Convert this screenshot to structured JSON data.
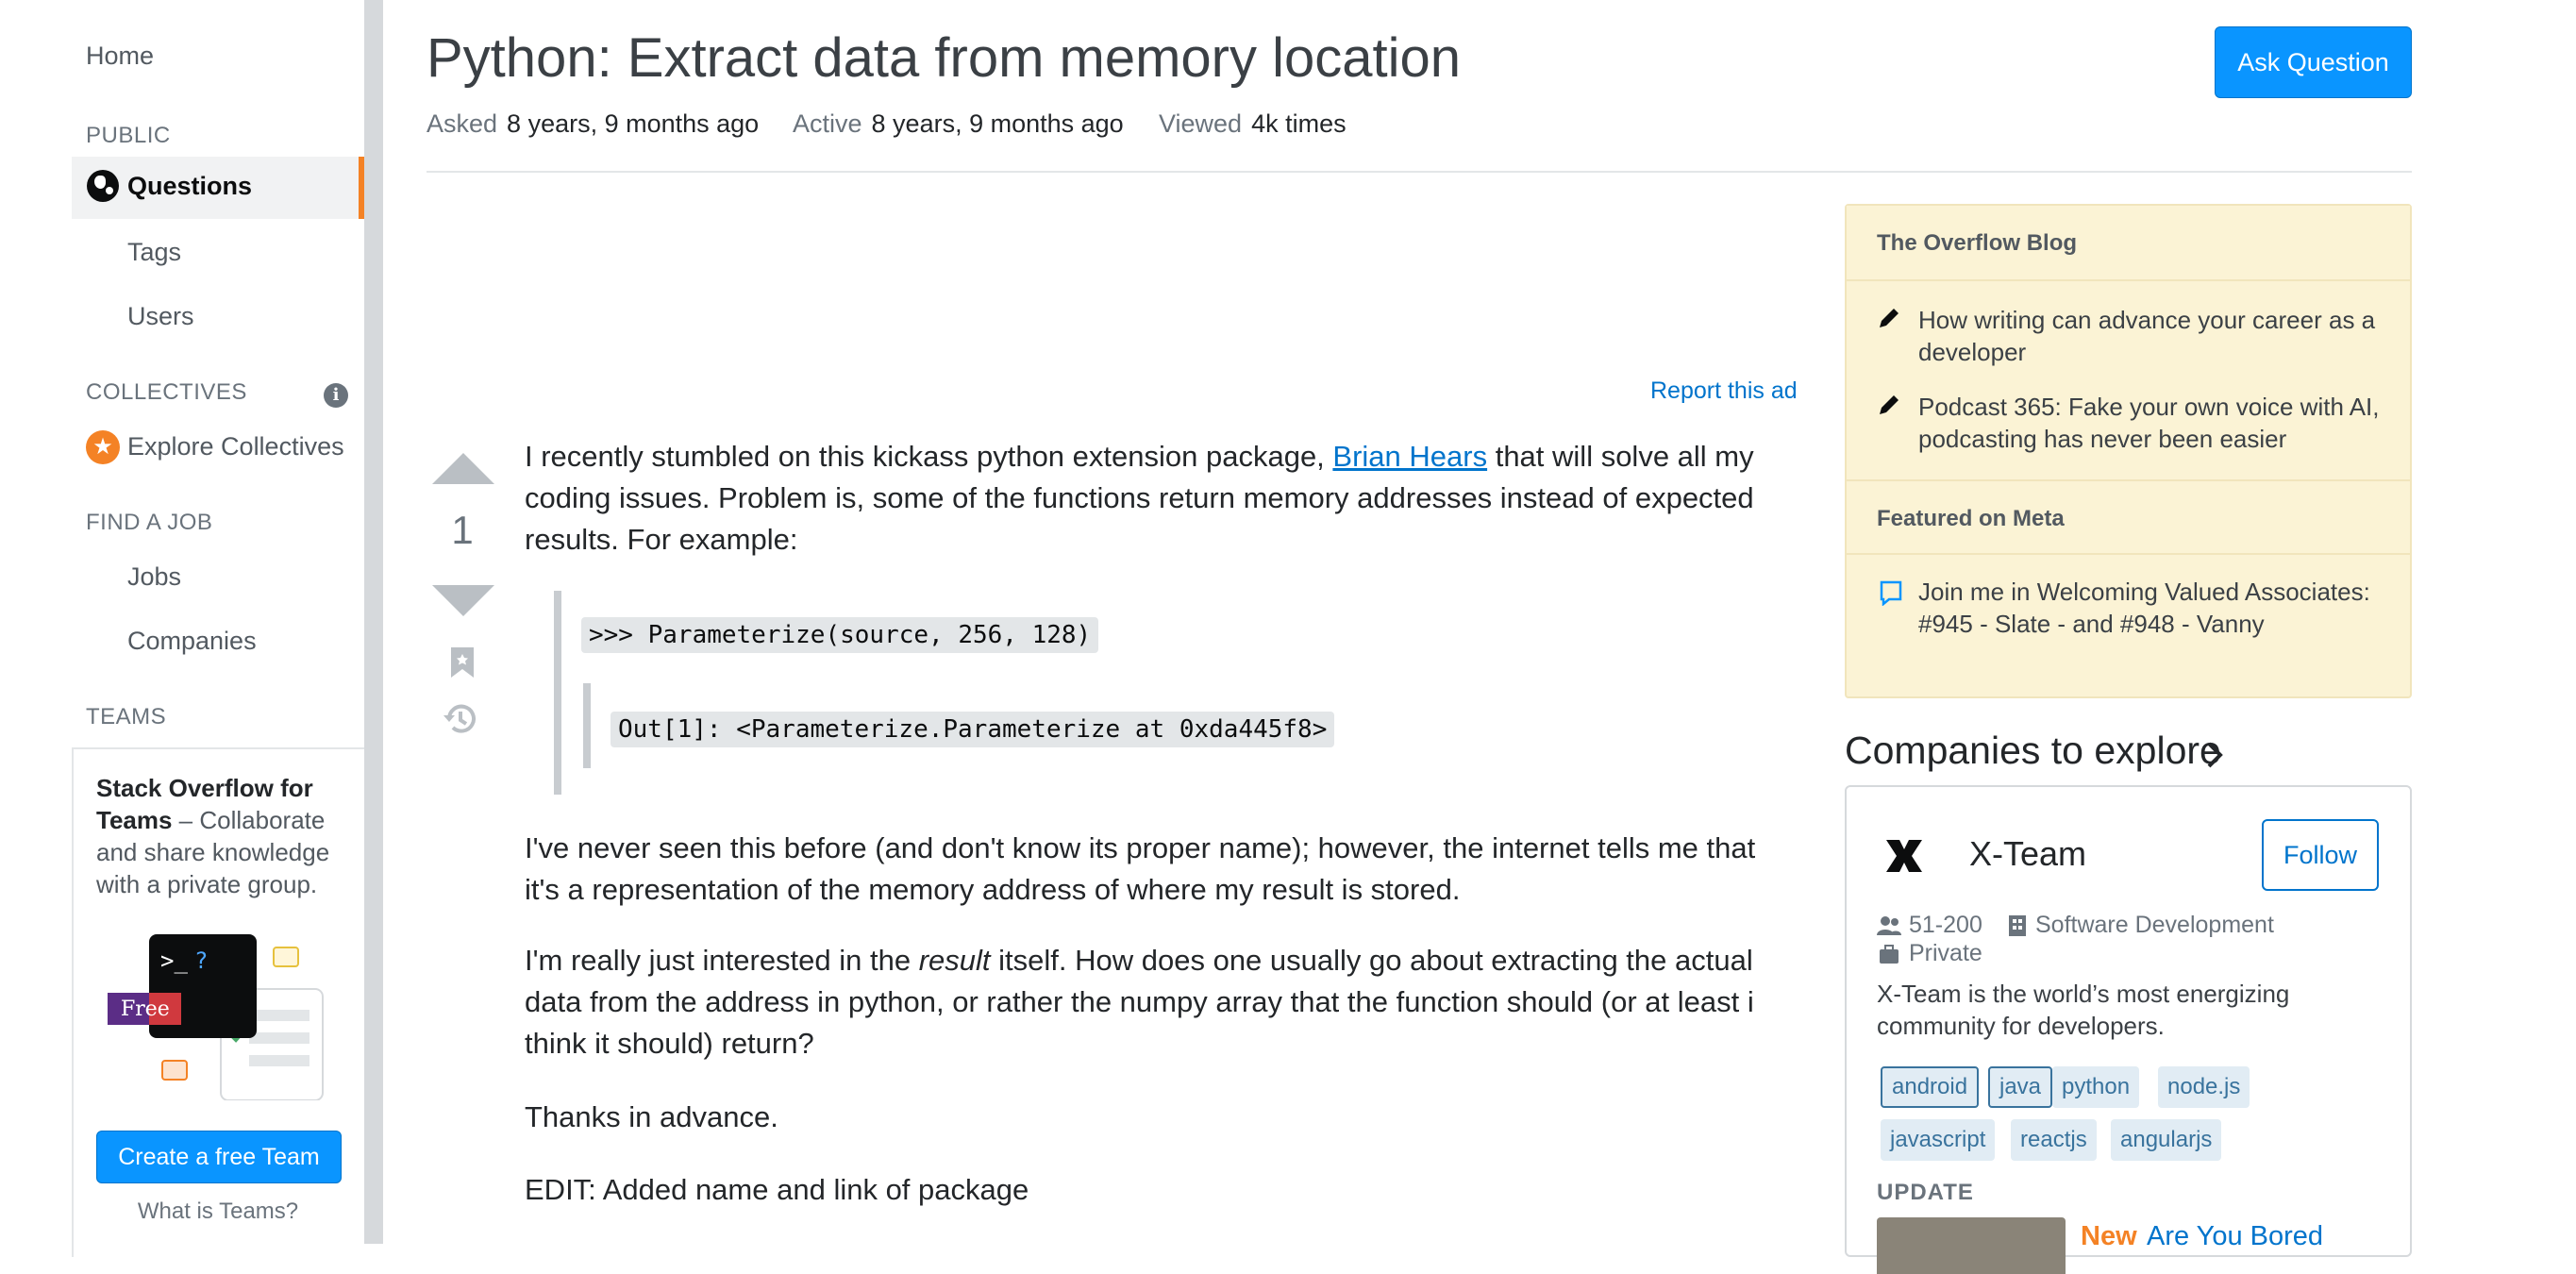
{
  "sidebar": {
    "home": "Home",
    "public_label": "PUBLIC",
    "questions": "Questions",
    "tags": "Tags",
    "users": "Users",
    "collectives_label": "COLLECTIVES",
    "explore_collectives": "Explore Collectives",
    "find_job_label": "FIND A JOB",
    "jobs": "Jobs",
    "companies": "Companies",
    "teams_label": "TEAMS",
    "teams_title": "Stack Overflow for Teams",
    "teams_blurb": " – Collaborate and share knowledge with a private group.",
    "free_badge": "Free",
    "create_team_button": "Create a free Team",
    "what_is_teams": "What is Teams?",
    "accent_color": "#f48225"
  },
  "question": {
    "title": "Python: Extract data from memory location",
    "ask_button": "Ask Question",
    "asked_label": "Asked",
    "asked_value": "8 years, 9 months ago",
    "active_label": "Active",
    "active_value": "8 years, 9 months ago",
    "viewed_label": "Viewed",
    "viewed_value": "4k times",
    "report_ad": "Report this ad",
    "vote_count": "1",
    "p1_before": "I recently stumbled on this kickass python extension package, ",
    "p1_link": "Brian Hears",
    "p1_after": " that will solve all my coding issues. Problem is, some of the functions return memory addresses instead of expected results. For example:",
    "code1": ">>> Parameterize(source, 256, 128)",
    "code2": "Out[1]: <Parameterize.Parameterize at 0xda445f8>",
    "p2": "I've never seen this before (and don't know its proper name); however, the internet tells me that it's a representation of the memory address of where my result is stored.",
    "p3_before": "I'm really just interested in the ",
    "p3_em": "result",
    "p3_after": " itself. How does one usually go about extracting the actual data from the address in python, or rather the numpy array that the function should (or at least i think it should) return?",
    "p4": "Thanks in advance.",
    "p5": "EDIT: Added name and link of package"
  },
  "blog": {
    "heading": "The Overflow Blog",
    "items": [
      "How writing can advance your career as a developer",
      "Podcast 365: Fake your own voice with AI, podcasting has never been easier"
    ],
    "meta_heading": "Featured on Meta",
    "meta_items": [
      "Join me in Welcoming Valued Associates: #945 - Slate - and #948 - Vanny"
    ]
  },
  "companies": {
    "title": "Companies to explore",
    "name": "X-Team",
    "follow": "Follow",
    "size": "51-200",
    "industry": "Software Development",
    "ownership": "Private",
    "description": "X-Team is the world’s most energizing community for developers.",
    "tags": [
      "android",
      "java",
      "python",
      "node.js",
      "javascript",
      "reactjs",
      "angularjs"
    ],
    "update_label": "UPDATE",
    "update_new": "New",
    "update_title": "Are You Bored"
  }
}
